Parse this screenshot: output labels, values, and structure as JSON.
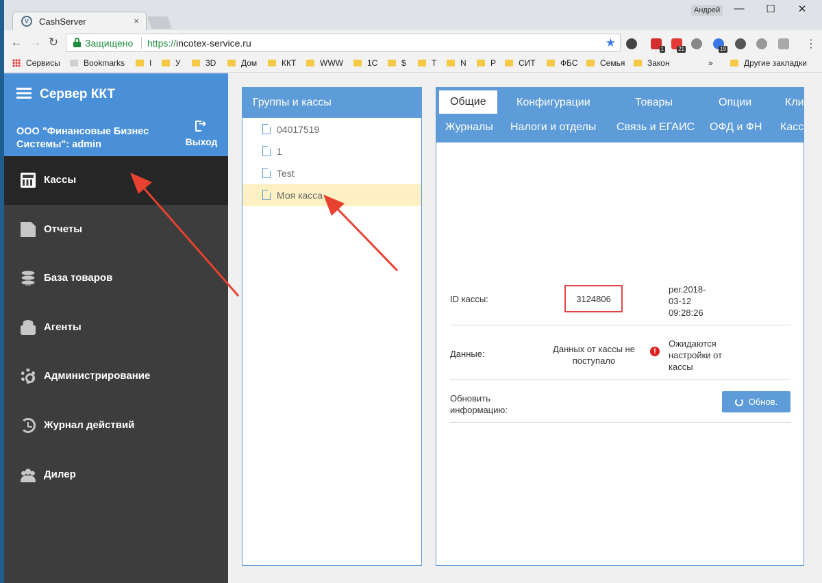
{
  "browser": {
    "tab_title": "CashServer",
    "tab_close": "×",
    "profile_name": "Андрей",
    "window_controls": [
      "—",
      "☐",
      "✕"
    ],
    "secure_label": "Защищено",
    "url_scheme": "https://",
    "url_host": "incotex-service.ru",
    "bookmarks": [
      {
        "label": "Сервисы",
        "type": "apps"
      },
      {
        "label": "Bookmarks",
        "type": "bookmark"
      },
      {
        "label": "I",
        "type": "folder"
      },
      {
        "label": "У",
        "type": "folder"
      },
      {
        "label": "3D",
        "type": "folder"
      },
      {
        "label": "Дом",
        "type": "folder"
      },
      {
        "label": "ККТ",
        "type": "folder"
      },
      {
        "label": "WWW",
        "type": "folder"
      },
      {
        "label": "1С",
        "type": "folder"
      },
      {
        "label": "$",
        "type": "folder"
      },
      {
        "label": "Т",
        "type": "folder"
      },
      {
        "label": "N",
        "type": "folder"
      },
      {
        "label": "Р",
        "type": "folder"
      },
      {
        "label": "СИТ",
        "type": "folder"
      },
      {
        "label": "ФБС",
        "type": "folder"
      },
      {
        "label": "Семья",
        "type": "folder"
      },
      {
        "label": "Закон",
        "type": "folder"
      }
    ],
    "bookmarks_more": "»",
    "other_bookmarks": "Другие закладки",
    "extension_badges": [
      "1",
      "21",
      "19"
    ]
  },
  "sidebar": {
    "brand": "Сервер ККТ",
    "org": "ООО \"Финансовые Бизнес Системы\": admin",
    "logout": "Выход",
    "items": [
      {
        "label": "Кассы",
        "icon": "calculator-icon",
        "active": true
      },
      {
        "label": "Отчеты",
        "icon": "document-icon",
        "active": false
      },
      {
        "label": "База товаров",
        "icon": "database-icon",
        "active": false
      },
      {
        "label": "Агенты",
        "icon": "agent-icon",
        "active": false
      },
      {
        "label": "Администрирование",
        "icon": "gear-icon",
        "active": false
      },
      {
        "label": "Журнал действий",
        "icon": "history-icon",
        "active": false
      },
      {
        "label": "Дилер",
        "icon": "users-icon",
        "active": false
      }
    ]
  },
  "groups": {
    "title": "Группы и кассы",
    "items": [
      {
        "label": "04017519",
        "selected": false
      },
      {
        "label": "1",
        "selected": false
      },
      {
        "label": "Test",
        "selected": false
      },
      {
        "label": "Моя касса",
        "selected": true
      }
    ]
  },
  "details": {
    "tabs_row1": [
      "Общие",
      "Конфигурации",
      "Товары",
      "Опции",
      "Кли"
    ],
    "tabs_row2": [
      "Журналы",
      "Налоги и отделы",
      "Связь и ЕГАИС",
      "ОФД и ФН",
      "Касс"
    ],
    "id_label": "ID кассы:",
    "id_value": "3124806",
    "reg_date": "рег.2018-03-12 09:28:26",
    "data_label": "Данные:",
    "no_data": "Данных от кассы не поступало",
    "awaiting": "Ожидаются настройки от кассы",
    "refresh_label": "Обновить информацию:",
    "refresh_button": "Обнов."
  },
  "colors": {
    "sidebar_head": "#4a90d9",
    "sidebar_bg": "#3d3d3d",
    "sidebar_active": "#262626",
    "panel_blue": "#5d9cd9",
    "selected_row": "#fdf0c2",
    "highlight_box": "#e04444",
    "annotation_arrow": "#e8412f"
  }
}
